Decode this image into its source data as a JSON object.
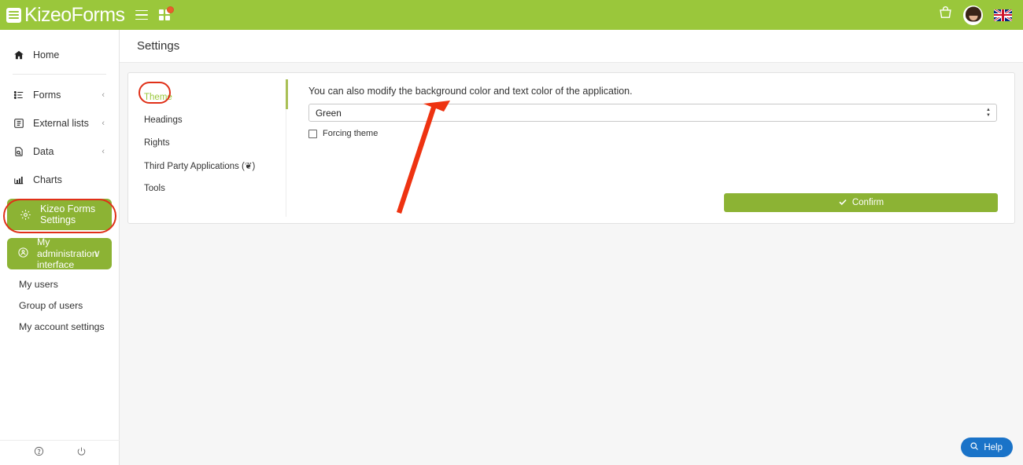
{
  "header": {
    "logo_text_1": "Kizeo",
    "logo_text_2": "Forms",
    "menu_icon": "hamburger-menu-icon",
    "apps_icon": "apps-grid-icon",
    "basket_icon": "shopping-basket-icon",
    "avatar_icon": "user-avatar",
    "language_icon": "uk-flag-icon",
    "brand_color": "#9ac73b"
  },
  "sidebar": {
    "home": {
      "label": "Home",
      "icon": "home-icon"
    },
    "items": [
      {
        "label": "Forms",
        "icon": "forms-list-icon",
        "chevron": "‹"
      },
      {
        "label": "External lists",
        "icon": "external-list-icon",
        "chevron": "‹"
      },
      {
        "label": "Data",
        "icon": "data-document-icon",
        "chevron": "‹"
      },
      {
        "label": "Charts",
        "icon": "charts-bar-icon",
        "chevron": ""
      }
    ],
    "active_item": {
      "label_line1": "Kizeo Forms",
      "label_line2": "Settings",
      "icon": "gear-icon"
    },
    "admin": {
      "label_line1": "My administration",
      "label_line2": "interface",
      "icon": "admin-user-icon",
      "chevron": "∨"
    },
    "sub_items": [
      {
        "label": "My users"
      },
      {
        "label": "Group of users"
      },
      {
        "label": "My account settings"
      }
    ],
    "footer": [
      {
        "icon": "help-circle-icon"
      },
      {
        "icon": "power-icon"
      }
    ],
    "active_color": "#8cb334"
  },
  "main": {
    "page_title": "Settings",
    "tabs": [
      {
        "label": "Theme",
        "active": true
      },
      {
        "label": "Headings",
        "active": false
      },
      {
        "label": "Rights",
        "active": false
      },
      {
        "label": "Third Party Applications (❦)",
        "active": false
      },
      {
        "label": "Tools",
        "active": false
      }
    ],
    "form": {
      "description": "You can also modify the background color and text color of the application.",
      "theme_select_value": "Green",
      "theme_select_options": [
        "Green"
      ],
      "checkbox_label": "Forcing theme",
      "checkbox_checked": false,
      "confirm_label": "Confirm",
      "confirm_icon": "checkmark-icon",
      "confirm_color": "#8cb334"
    }
  },
  "help": {
    "label": "Help",
    "icon": "search-icon",
    "color": "#1a73c8"
  },
  "annotations": {
    "circle_tab": "Theme",
    "circle_sidebar": "Kizeo Forms Settings",
    "arrow_color": "#ee3311"
  }
}
